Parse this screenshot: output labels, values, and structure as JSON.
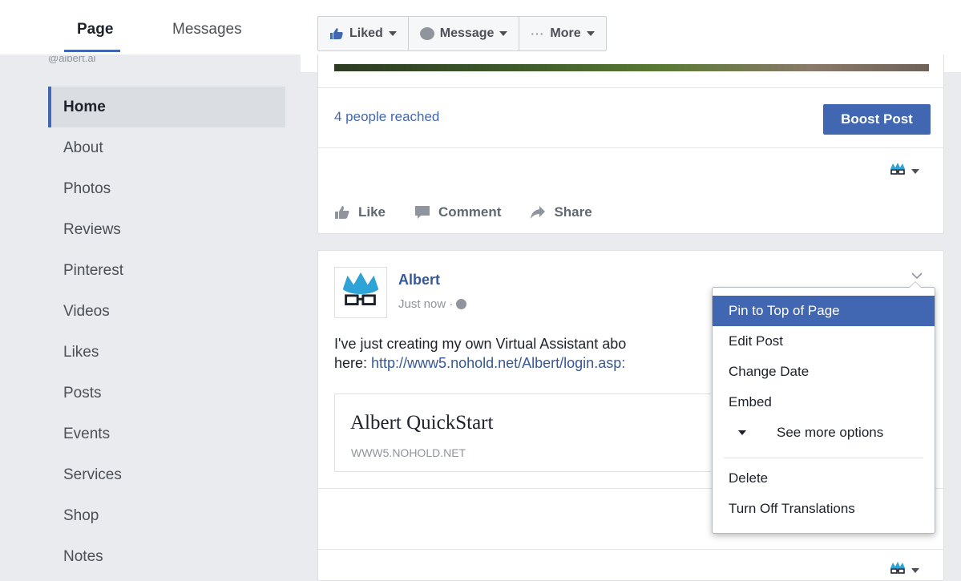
{
  "tabs": {
    "page": "Page",
    "messages": "Messages",
    "cut_text": "@albert.ai"
  },
  "nav": {
    "items": [
      {
        "label": "Home",
        "active": true
      },
      {
        "label": "About"
      },
      {
        "label": "Photos"
      },
      {
        "label": "Reviews"
      },
      {
        "label": "Pinterest"
      },
      {
        "label": "Videos"
      },
      {
        "label": "Likes"
      },
      {
        "label": "Posts"
      },
      {
        "label": "Events"
      },
      {
        "label": "Services"
      },
      {
        "label": "Shop"
      },
      {
        "label": "Notes"
      }
    ]
  },
  "toolbar": {
    "liked": "Liked",
    "message": "Message",
    "more": "More",
    "more_dots": "···"
  },
  "post1": {
    "reach": "4 people reached",
    "boost": "Boost Post",
    "actions": {
      "like": "Like",
      "comment": "Comment",
      "share": "Share"
    }
  },
  "post2": {
    "author": "Albert",
    "time": "Just now ·",
    "text_line1": "I've just creating my own Virtual Assistant abo",
    "text_line2_prefix": "here: ",
    "text_line2_link": "http://www5.nohold.net/Albert/login.asp:",
    "link_title": "Albert QuickStart",
    "link_domain": "WWW5.NOHOLD.NET"
  },
  "menu": {
    "pin": "Pin to Top of Page",
    "edit": "Edit Post",
    "change_date": "Change Date",
    "embed": "Embed",
    "see_more": "See more options",
    "delete": "Delete",
    "translations": "Turn Off Translations"
  },
  "colors": {
    "accent": "#4267b2",
    "link": "#365899"
  }
}
